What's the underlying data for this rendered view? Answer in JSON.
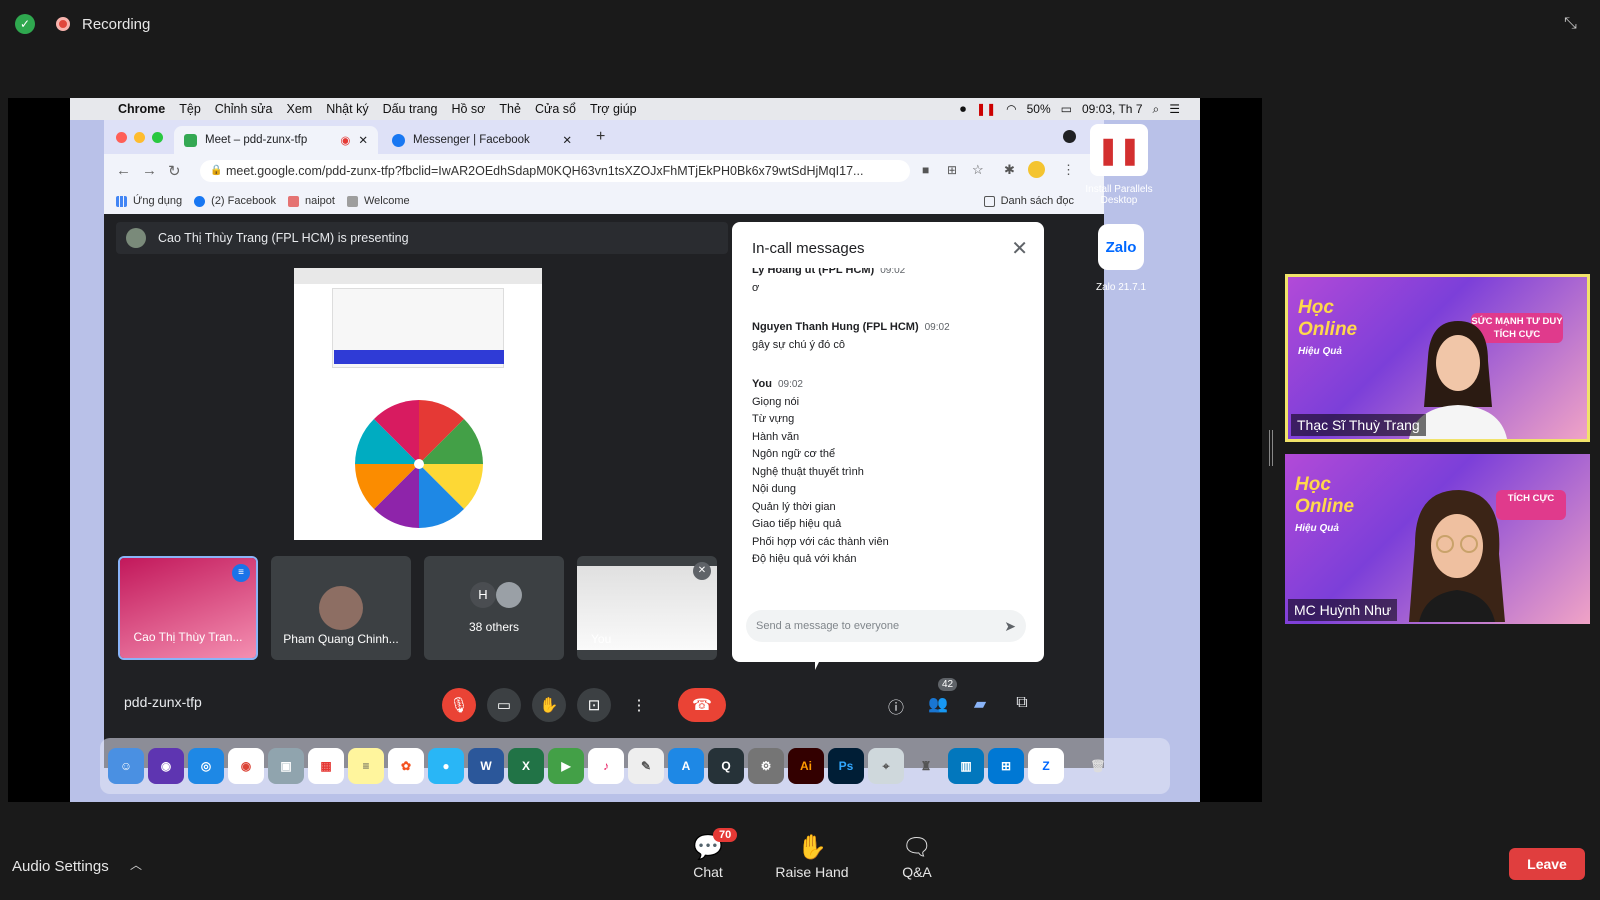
{
  "topbar": {
    "recording_label": "Recording"
  },
  "mac_menubar": {
    "items": [
      "Chrome",
      "Tệp",
      "Chỉnh sửa",
      "Xem",
      "Nhật ký",
      "Dấu trang",
      "Hồ sơ",
      "Thẻ",
      "Cửa sổ",
      "Trợ giúp"
    ],
    "battery": "50%",
    "clock": "09:03, Th 7"
  },
  "browser": {
    "tabs": [
      {
        "label": "Meet – pdd-zunx-tfp"
      },
      {
        "label": "Messenger | Facebook"
      }
    ],
    "url": "meet.google.com/pdd-zunx-tfp?fbclid=IwAR2OEdhSdapM0KQH63vn1tsXZOJxFhMTjEkPH0Bk6x79wtSdHjMqI17...",
    "bookmarks": [
      "Ứng dụng",
      "(2) Facebook",
      "naipot",
      "Welcome"
    ],
    "reading_list": "Danh sách đọc"
  },
  "meet": {
    "presenting_text": "Cao Thị Thùy Trang (FPL HCM) is presenting",
    "tiles": [
      {
        "name": "Cao Thị Thùy Tran..."
      },
      {
        "name": "Pham Quang Chinh..."
      },
      {
        "name": "38 others",
        "initial": "H"
      },
      {
        "name": "You"
      }
    ],
    "meeting_code": "pdd-zunx-tfp",
    "participants_count": "42",
    "panel": {
      "title": "In-call messages",
      "messages": [
        {
          "sender": "Ly Hoang ut (FPL HCM)",
          "time": "09:02",
          "lines": [
            "ơ"
          ]
        },
        {
          "sender": "Nguyen Thanh Hung (FPL HCM)",
          "time": "09:02",
          "lines": [
            "gây sự chú ý đó cô"
          ]
        },
        {
          "sender": "You",
          "time": "09:02",
          "lines": [
            "Giọng nói",
            "Từ vựng",
            "Hành văn",
            "Ngôn ngữ cơ thể",
            "Nghệ thuật thuyết trình",
            "Nội dung",
            "Quản lý thời gian",
            "Giao tiếp hiệu quả",
            "Phối hợp với các thành viên",
            "Độ hiệu quả với khán"
          ]
        }
      ],
      "input_placeholder": "Send a message to everyone"
    }
  },
  "desktop": {
    "parallels_label": "Install Parallels Desktop",
    "zalo_label": "Zalo 21.7.1"
  },
  "videos": [
    {
      "name": "Thạc Sĩ Thuỳ Trang",
      "brand": "Học Online",
      "brand_sub": "Hiệu Quả",
      "ribbon": "SỨC MẠNH TƯ DUY TÍCH CỰC"
    },
    {
      "name": "MC Huỳnh Như",
      "brand": "Học Online",
      "brand_sub": "Hiệu Quả",
      "ribbon": "TÍCH CỰC"
    }
  ],
  "bottombar": {
    "audio_settings": "Audio Settings",
    "chat_label": "Chat",
    "chat_badge": "70",
    "raise_hand_label": "Raise Hand",
    "qa_label": "Q&A",
    "leave_label": "Leave"
  }
}
